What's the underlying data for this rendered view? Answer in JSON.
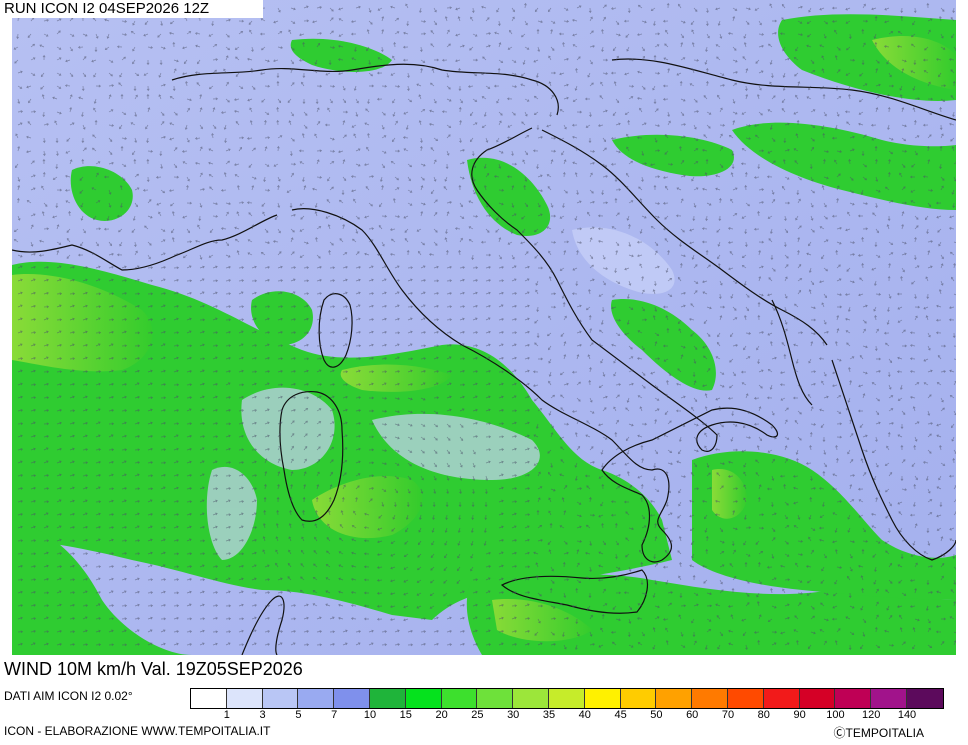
{
  "map": {
    "run_label": "RUN ICON I2 04SEP2026 12Z",
    "title": "WIND 10M km/h Val. 19Z05SEP2026",
    "data_source": "DATI AIM ICON I2 0.02°",
    "footer_left": "ICON - ELABORAZIONE WWW.TEMPOITALIA.IT",
    "footer_right": "ⒸTEMPOITALIA",
    "region": "Italy and central Mediterranean",
    "field": "10 m wind speed with direction arrows"
  },
  "legend": {
    "unit": "km/h",
    "colors": [
      "#ffffff",
      "#dce4fb",
      "#b9c6f5",
      "#99aaf1",
      "#7f90ec",
      "#1fb43a",
      "#05e21d",
      "#3de02d",
      "#6ee13a",
      "#9ce63a",
      "#c6ec2a",
      "#fff100",
      "#ffcc00",
      "#ffa100",
      "#ff7a00",
      "#ff4a00",
      "#f21a1a",
      "#d50026",
      "#bf0055",
      "#a1138b",
      "#5c0a5c"
    ],
    "labels": [
      "1",
      "3",
      "5",
      "7",
      "10",
      "15",
      "20",
      "25",
      "30",
      "35",
      "40",
      "45",
      "50",
      "60",
      "70",
      "80",
      "90",
      "100",
      "120",
      "140"
    ]
  },
  "colors": {
    "calm_blue": "#a9b5ee",
    "light_blue": "#c8d0f7",
    "wind_green": "#2dcc2d",
    "wind_lime": "#8fdc32",
    "arrow_dark": "#555a70",
    "border_black": "#111111"
  }
}
